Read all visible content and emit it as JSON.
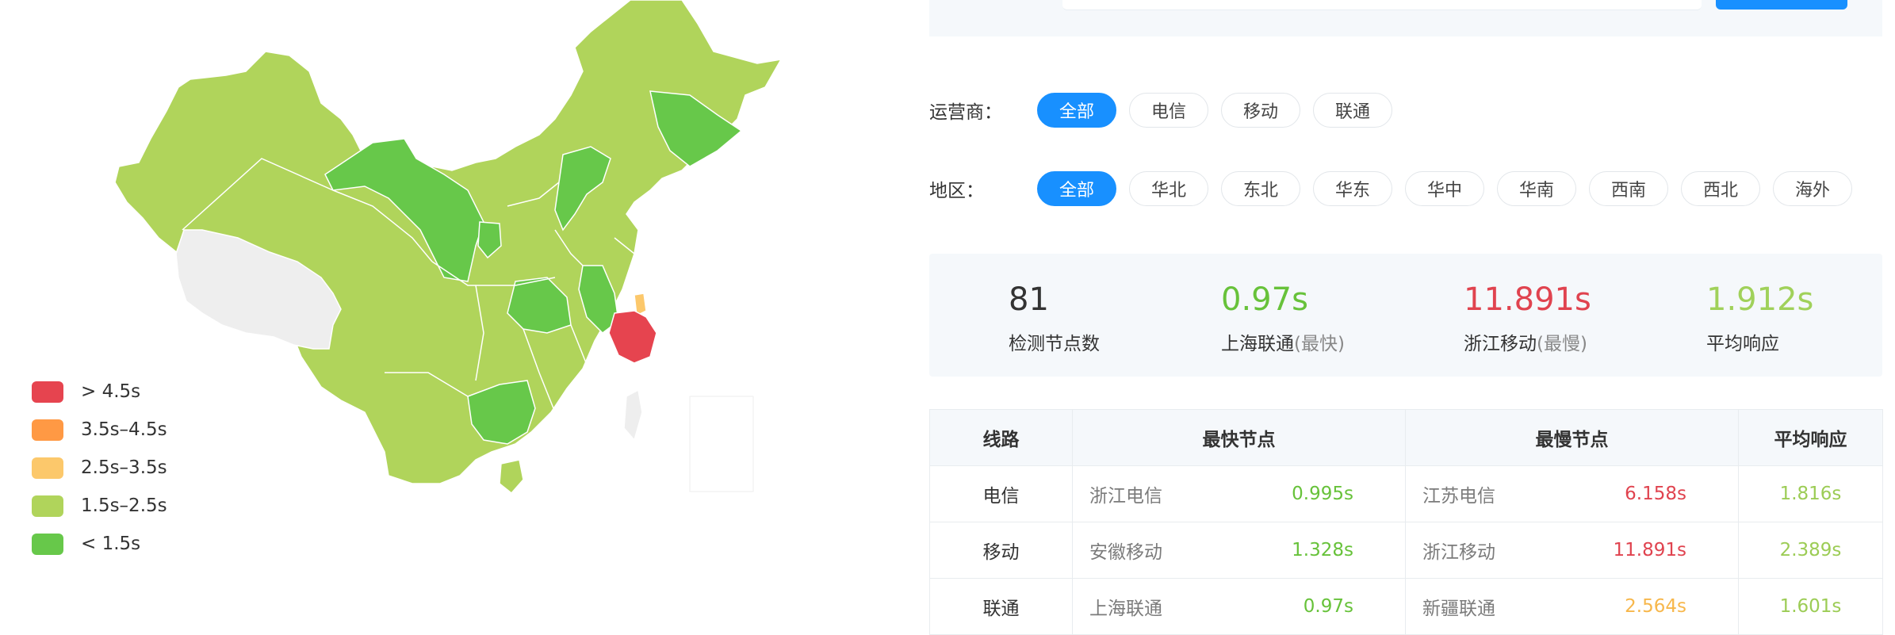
{
  "map": {
    "colors": {
      "base": "#b0d45b",
      "fast": "#67c84a",
      "warn": "#fcc86b",
      "slow": "#e6444f",
      "noData": "#eeeeee",
      "border": "#ffffff"
    }
  },
  "legend": [
    {
      "label": "> 4.5s",
      "color": "#e6444f"
    },
    {
      "label": "3.5s–4.5s",
      "color": "#ff9944"
    },
    {
      "label": "2.5s–3.5s",
      "color": "#fcc86b"
    },
    {
      "label": "1.5s–2.5s",
      "color": "#b0d45b"
    },
    {
      "label": "< 1.5s",
      "color": "#67c84a"
    }
  ],
  "filters": {
    "carrier": {
      "label": "运营商：",
      "options": [
        "全部",
        "电信",
        "移动",
        "联通"
      ],
      "selected": "全部"
    },
    "region": {
      "label": "地区：",
      "options": [
        "全部",
        "华北",
        "东北",
        "华东",
        "华中",
        "华南",
        "西南",
        "西北",
        "海外"
      ],
      "selected": "全部"
    }
  },
  "stats": {
    "nodes": {
      "value": "81",
      "label": "检测节点数",
      "color": "#333333"
    },
    "fastest": {
      "value": "0.97s",
      "label": "上海联通",
      "sub": "(最快)",
      "color": "#67c23a"
    },
    "slowest": {
      "value": "11.891s",
      "label": "浙江移动",
      "sub": "(最慢)",
      "color": "#e0434f"
    },
    "average": {
      "value": "1.912s",
      "label": "平均响应",
      "color": "#a0d15a"
    }
  },
  "table": {
    "headers": [
      "线路",
      "最快节点",
      "最慢节点",
      "平均响应"
    ],
    "rows": [
      {
        "line": "电信",
        "fastNode": "浙江电信",
        "fastTime": "0.995s",
        "slowNode": "江苏电信",
        "slowTime": "6.158s",
        "avg": "1.816s"
      },
      {
        "line": "移动",
        "fastNode": "安徽移动",
        "fastTime": "1.328s",
        "slowNode": "浙江移动",
        "slowTime": "11.891s",
        "avg": "2.389s"
      },
      {
        "line": "联通",
        "fastNode": "上海联通",
        "fastTime": "0.97s",
        "slowNode": "新疆联通",
        "slowTime": "2.564s",
        "avg": "1.601s"
      }
    ],
    "timeColors": {
      "fast": "#67c23a",
      "slow": "#e0434f",
      "warn": "#f7b74b",
      "avg": "#9ccc55"
    }
  }
}
